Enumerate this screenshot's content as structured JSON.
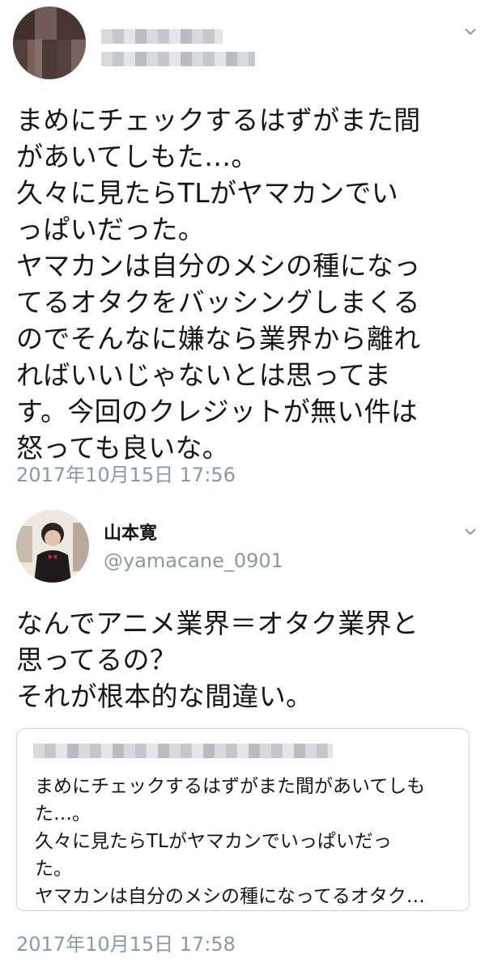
{
  "tweets": [
    {
      "text": "まめにチェックするはずがまた間\nがあいてしもた…。\n久々に見たらTLがヤマカンでい\nっぱいだった。\nヤマカンは自分のメシの種になっ\nてるオタクをバッシングしまくる\nのでそんなに嫌なら業界から離れ\nればいいじゃないとは思ってま\nす。今回のクレジットが無い件は\n怒っても良いな。",
      "timestamp": "2017年10月15日 17:56",
      "avatar_icon": "blurred-avatar"
    },
    {
      "name": "山本寛",
      "handle": "@yamacane_0901",
      "text": "なんでアニメ業界＝オタク業界と\n思ってるの？\nそれが根本的な間違い。",
      "quote_text": "まめにチェックするはずがまた間があいてしも\nた…。\n久々に見たらTLがヤマカンでいっぱいだっ\nた。\nヤマカンは自分のメシの種になってるオタク…",
      "timestamp": "2017年10月15日 17:58",
      "avatar_icon": "profile-photo"
    }
  ],
  "colors": {
    "text": "#14171a",
    "secondary": "#8899a6",
    "border": "#ccd6dd",
    "avatar_bg": "#ede7df"
  },
  "icons": {
    "menu": "chevron-down-icon"
  }
}
